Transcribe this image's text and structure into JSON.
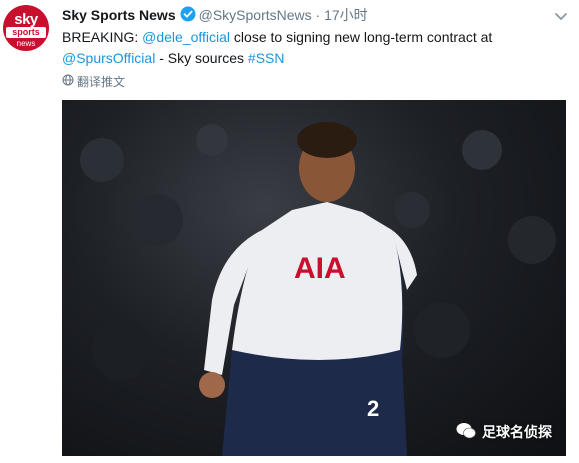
{
  "account": {
    "name": "Sky Sports News",
    "handle": "@SkySportsNews",
    "separator": "·",
    "time": "17小时",
    "avatar": {
      "line1": "sky",
      "line2": "sports",
      "line3": "news"
    }
  },
  "tweet": {
    "prefix": "BREAKING: ",
    "mention1": "@dele_official",
    "middle": " close to signing new long-term contract at ",
    "mention2": "@SpursOfficial",
    "suffix": " - Sky sources ",
    "hashtag": "#SSN"
  },
  "translate_label": "翻译推文",
  "watermark": "足球名侦探",
  "colors": {
    "link": "#1b95e0",
    "brand": "#c8102e",
    "text": "#14171a",
    "muted": "#657786"
  }
}
